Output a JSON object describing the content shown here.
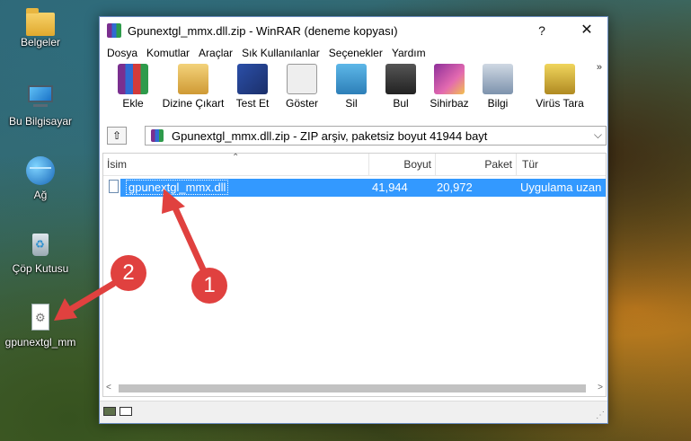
{
  "desktop": {
    "icons": [
      {
        "label": "Belgeler"
      },
      {
        "label": "Bu Bilgisayar"
      },
      {
        "label": "Ağ"
      },
      {
        "label": "Çöp Kutusu"
      },
      {
        "label": "gpunextgl_mm"
      }
    ]
  },
  "window": {
    "title": "Gpunextgl_mmx.dll.zip - WinRAR (deneme kopyası)",
    "help_btn": "?",
    "close_btn": "✕"
  },
  "menu": [
    "Dosya",
    "Komutlar",
    "Araçlar",
    "Sık Kullanılanlar",
    "Seçenekler",
    "Yardım"
  ],
  "toolbar": [
    {
      "label": "Ekle",
      "icon": "add-books-icon"
    },
    {
      "label": "Dizine Çıkart",
      "icon": "extract-folder-icon"
    },
    {
      "label": "Test Et",
      "icon": "test-book-icon"
    },
    {
      "label": "Göster",
      "icon": "glasses-icon"
    },
    {
      "label": "Sil",
      "icon": "delete-icon"
    },
    {
      "label": "Bul",
      "icon": "binoculars-icon"
    },
    {
      "label": "Sihirbaz",
      "icon": "wizard-icon"
    },
    {
      "label": "Bilgi",
      "icon": "info-icon"
    },
    {
      "label": "Virüs Tara",
      "icon": "virus-scan-icon"
    }
  ],
  "toolbar_more": "»",
  "address": {
    "up_icon": "⇧",
    "text": "Gpunextgl_mmx.dll.zip - ZIP arşiv, paketsiz boyut 41944 bayt",
    "dropdown": "⌵"
  },
  "columns": {
    "name": "İsim",
    "size": "Boyut",
    "packed": "Paket",
    "type": "Tür",
    "sort_arrow": "⌃"
  },
  "files": [
    {
      "name": "gpunextgl_mmx.dll",
      "size": "41,944",
      "packed": "20,972",
      "type": "Uygulama uzan"
    }
  ],
  "scroll": {
    "left": "<",
    "right": ">"
  },
  "status": {
    "grip": "⋰"
  },
  "annotations": [
    {
      "number": "1",
      "color": "#e0413f"
    },
    {
      "number": "2",
      "color": "#e0413f"
    }
  ]
}
